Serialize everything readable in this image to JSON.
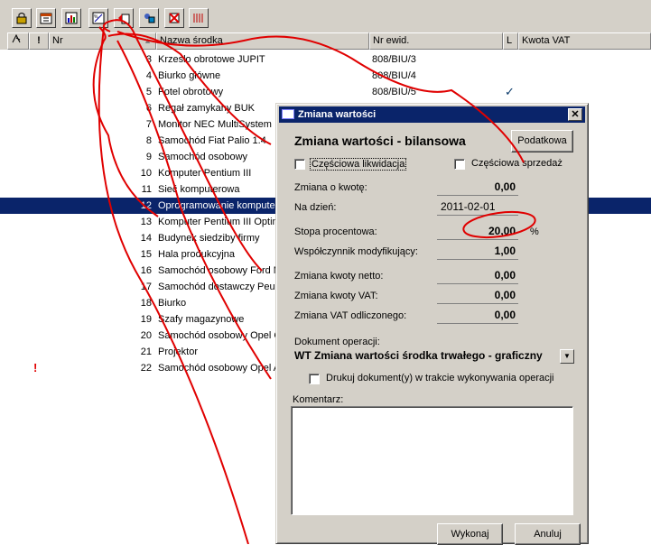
{
  "toolbar": {
    "buttons": [
      {
        "name": "lock-icon"
      },
      {
        "name": "calendar-icon"
      },
      {
        "name": "chart-icon"
      },
      {
        "name": "value-change-icon"
      },
      {
        "name": "export-icon"
      },
      {
        "name": "transfer-icon"
      },
      {
        "name": "delete-icon"
      },
      {
        "name": "barcode-icon"
      }
    ]
  },
  "table": {
    "headers": {
      "nr": "Nr",
      "nazwa": "Nazwa środka",
      "ewid": "Nr ewid.",
      "l": "L",
      "vat": "Kwota VAT"
    },
    "rows": [
      {
        "nr": "3",
        "name": "Krzesło obrotowe JUPIT",
        "ewid": "808/BIU/3"
      },
      {
        "nr": "4",
        "name": "Biurko główne",
        "ewid": "808/BIU/4"
      },
      {
        "nr": "5",
        "name": "Fotel obrotowy",
        "ewid": "808/BIU/5"
      },
      {
        "nr": "6",
        "name": "Regał zamykany BUK",
        "ewid": ""
      },
      {
        "nr": "7",
        "name": "Monitor NEC MultiSystem",
        "ewid": ""
      },
      {
        "nr": "8",
        "name": "Samochód Fiat Palio 1.4",
        "ewid": ""
      },
      {
        "nr": "9",
        "name": "Samochód osobowy",
        "ewid": ""
      },
      {
        "nr": "10",
        "name": "Komputer Pentium III",
        "ewid": ""
      },
      {
        "nr": "11",
        "name": "Sieć komputerowa",
        "ewid": ""
      },
      {
        "nr": "12",
        "name": "Oprogramowanie komputer",
        "ewid": ""
      },
      {
        "nr": "13",
        "name": "Komputer Pentium III Optim",
        "ewid": ""
      },
      {
        "nr": "14",
        "name": "Budynek siedziby firmy",
        "ewid": ""
      },
      {
        "nr": "15",
        "name": "Hala produkcyjna",
        "ewid": ""
      },
      {
        "nr": "16",
        "name": "Samochód osobowy Ford M",
        "ewid": ""
      },
      {
        "nr": "17",
        "name": "Samochód dostawczy Peug",
        "ewid": ""
      },
      {
        "nr": "18",
        "name": "Biurko",
        "ewid": ""
      },
      {
        "nr": "19",
        "name": "Szafy magazynowe",
        "ewid": ""
      },
      {
        "nr": "20",
        "name": "Samochód osobowy Opel C",
        "ewid": ""
      },
      {
        "nr": "21",
        "name": "Projektor",
        "ewid": ""
      },
      {
        "nr": "22",
        "name": "Samochód osobowy Opel A",
        "ewid": ""
      }
    ],
    "selected_nr": "12",
    "warning_mark": "!",
    "check_mark": "✓"
  },
  "dialog": {
    "title": "Zmiana wartości",
    "close_glyph": "✕",
    "heading": "Zmiana wartości - bilansowa",
    "podatkowa_label": "Podatkowa",
    "czesciowa_likwidacja": "Częściowa likwidacja",
    "czesciowa_sprzedaz": "Częściowa sprzedaż",
    "fields": {
      "zmiana_o_kwote": {
        "label": "Zmiana o kwotę:",
        "value": "0,00"
      },
      "na_dzien": {
        "label": "Na dzień:",
        "value": "2011-02-01"
      },
      "stopa": {
        "label": "Stopa procentowa:",
        "value": "20,00",
        "suffix": "%"
      },
      "wspolczynnik": {
        "label": "Współczynnik modyfikujący:",
        "value": "1,00"
      },
      "netto": {
        "label": "Zmiana kwoty netto:",
        "value": "0,00"
      },
      "vat": {
        "label": "Zmiana kwoty VAT:",
        "value": "0,00"
      },
      "vat_odl": {
        "label": "Zmiana VAT odliczonego:",
        "value": "0,00"
      }
    },
    "dokument_label": "Dokument operacji:",
    "dokument_value": "WT Zmiana wartości środka trwałego - graficzny",
    "drukuj_label": "Drukuj dokument(y) w trakcie wykonywania operacji",
    "komentarz_label": "Komentarz:",
    "wykonaj_label": "Wykonaj",
    "anuluj_label": "Anuluj"
  },
  "colors": {
    "selection": "#0a246a",
    "annotation": "#e00000"
  }
}
